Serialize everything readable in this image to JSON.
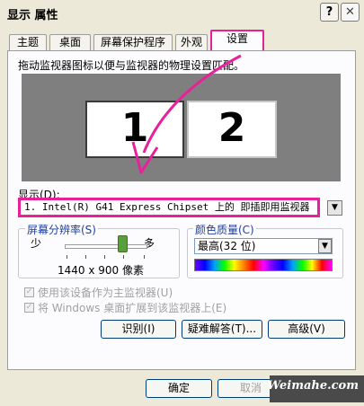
{
  "window": {
    "title": "显示 属性",
    "help_btn": "?",
    "close_btn": "✕"
  },
  "tabs": [
    {
      "label": "主题"
    },
    {
      "label": "桌面"
    },
    {
      "label": "屏幕保护程序"
    },
    {
      "label": "外观"
    },
    {
      "label": "设置"
    }
  ],
  "settings": {
    "description": "拖动监视器图标以便与监视器的物理设置匹配。",
    "monitors": [
      "1",
      "2"
    ],
    "display_label": "显示(D):",
    "display_value": "1. Intel(R) G41 Express Chipset 上的 即插即用监视器",
    "resolution": {
      "title": "屏幕分辨率(S)",
      "min_label": "少",
      "max_label": "多",
      "value_text": "1440 x 900 像素"
    },
    "color_quality": {
      "title": "颜色质量(C)",
      "value": "最高(32 位)"
    },
    "primary_check": "使用该设备作为主监视器(U)",
    "extend_check": "将 Windows 桌面扩展到该监视器上(E)",
    "buttons": {
      "identify": "识别(I)",
      "troubleshoot": "疑难解答(T)...",
      "advanced": "高级(V)"
    }
  },
  "footer": {
    "ok": "确定",
    "cancel": "取消",
    "watermark": "Weimahe.com"
  },
  "colors": {
    "highlight": "#e8209a",
    "dialog_bg": "#ece9d8",
    "panel_bg": "#fcfcfe",
    "preview_bg": "#7f7f7f"
  }
}
